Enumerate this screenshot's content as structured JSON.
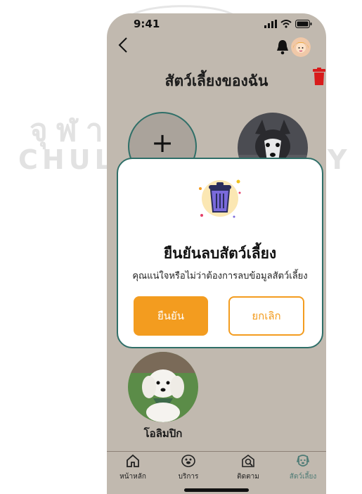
{
  "watermark": {
    "thai_left": "จุฬาล",
    "thai_right": "ย",
    "english_left": "CHULAL",
    "english_right": "ITY"
  },
  "status_bar": {
    "time": "9:41"
  },
  "header": {
    "title": "สัตว์เลี้ยงของฉัน"
  },
  "pets": [
    {
      "name": ""
    },
    {
      "name": "โอลิมปิก"
    }
  ],
  "modal": {
    "title": "ยืนยันลบสัตว์เลี้ยง",
    "message": "คุณแน่ใจหรือไม่ว่าต้องการลบข้อมูลสัตว์เลี้ยง",
    "confirm_label": "ยืนยัน",
    "cancel_label": "ยกเลิก"
  },
  "tab_bar": {
    "tabs": [
      {
        "label": "หน้าหลัก",
        "icon": "home-icon"
      },
      {
        "label": "บริการ",
        "icon": "pet-service-icon"
      },
      {
        "label": "ติดตาม",
        "icon": "track-search-icon"
      },
      {
        "label": "สัตว์เลี้ยง",
        "icon": "dog-face-icon"
      }
    ],
    "active_index": 3
  },
  "colors": {
    "background": "#c1b9af",
    "accent": "#f39c1f",
    "border_teal": "#2f6f68",
    "delete_red": "#d81b1b",
    "active_tab": "#4f7c76"
  }
}
